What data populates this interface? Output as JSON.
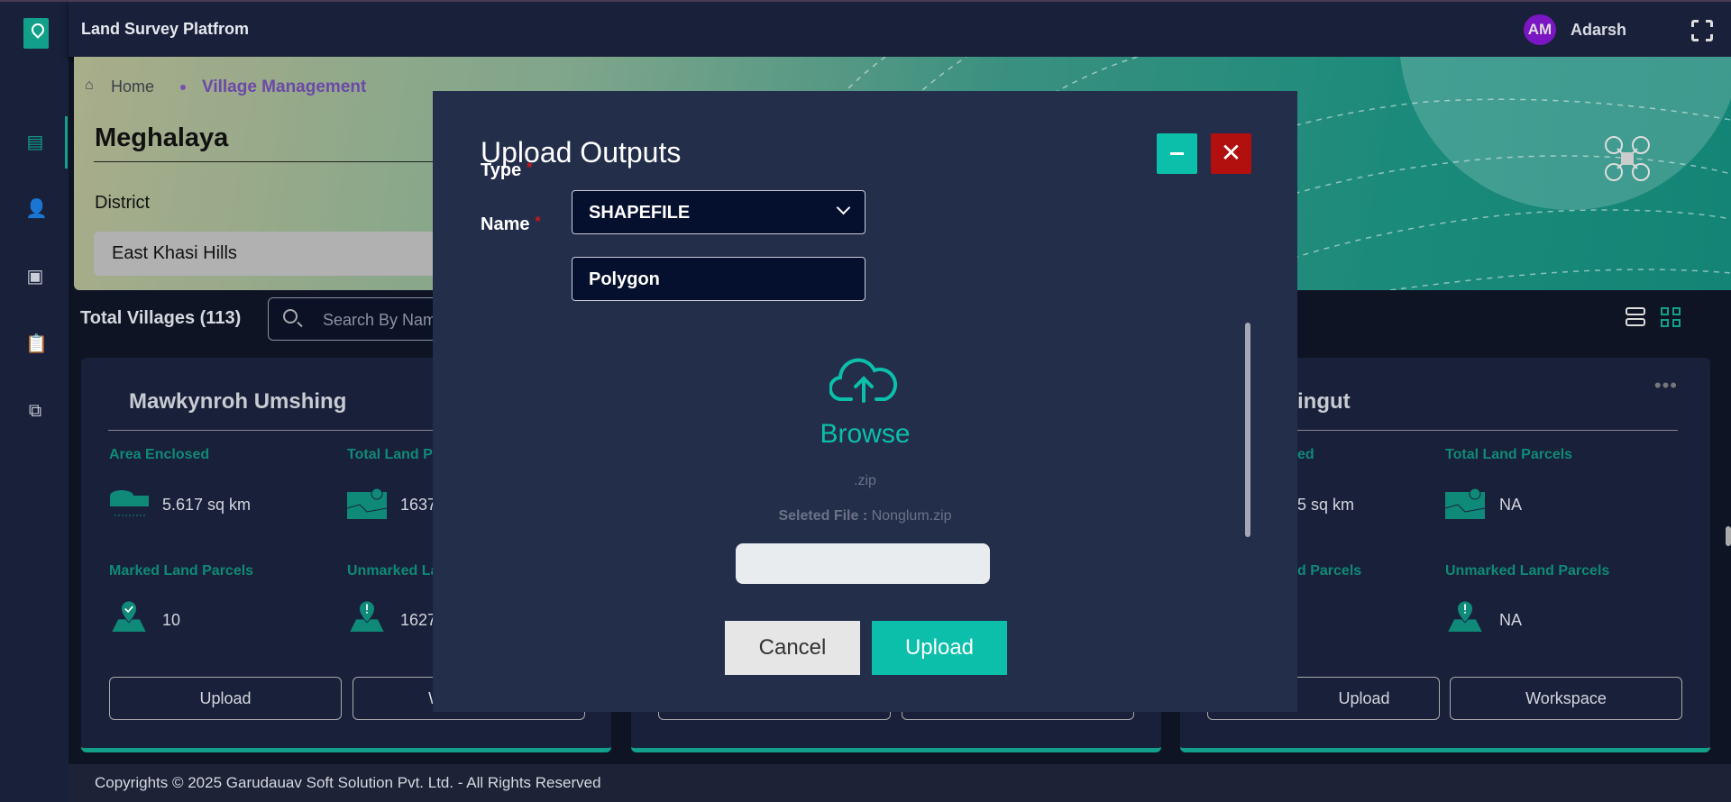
{
  "header": {
    "app_title": "Land Survey Platfrom",
    "avatar_initials": "AM",
    "user_name": "Adarsh"
  },
  "breadcrumb": {
    "home": "Home",
    "current": "Village Management"
  },
  "banner": {
    "state": "Meghalaya",
    "district_label": "District",
    "district_value": "East Khasi Hills"
  },
  "toolbar": {
    "total_villages": "Total Villages (113)",
    "search_placeholder": "Search By Name"
  },
  "cards": [
    {
      "title": "Mawkynroh Umshing",
      "area_label": "Area Enclosed",
      "area_value": "5.617 sq km",
      "total_label": "Total Land Parcels",
      "total_value": "1637",
      "marked_label": "Marked Land Parcels",
      "marked_value": "10",
      "unmarked_label": "Unmarked Land Parcels",
      "unmarked_value": "1627",
      "upload": "Upload",
      "workspace": "Workspace"
    },
    {
      "upload": "",
      "workspace": ""
    },
    {
      "title": "ingut",
      "area_label": "ed",
      "area_value": "5 sq km",
      "total_label": "Total Land Parcels",
      "total_value": "NA",
      "marked_label": "d Parcels",
      "unmarked_label": "Unmarked Land Parcels",
      "unmarked_value": "NA",
      "upload": "Upload",
      "workspace": "Workspace"
    }
  ],
  "footer": {
    "text": "Copyrights © 2025 Garudauav Soft Solution Pvt. Ltd. - All Rights Reserved"
  },
  "modal": {
    "title": "Upload Outputs",
    "close_glyph": "✕",
    "type_label": "Type",
    "type_value": "SHAPEFILE",
    "name_label": "Name",
    "name_value": "Polygon",
    "required": "*",
    "browse": "Browse",
    "accepted_ext": ".zip",
    "selected_label": "Seleted File :",
    "selected_file": "Nonglum.zip",
    "progress_percent": 0,
    "cancel": "Cancel",
    "upload": "Upload"
  },
  "colors": {
    "accent": "#0bbfaa",
    "danger": "#b20f0f",
    "avatar": "#7a16c2"
  }
}
